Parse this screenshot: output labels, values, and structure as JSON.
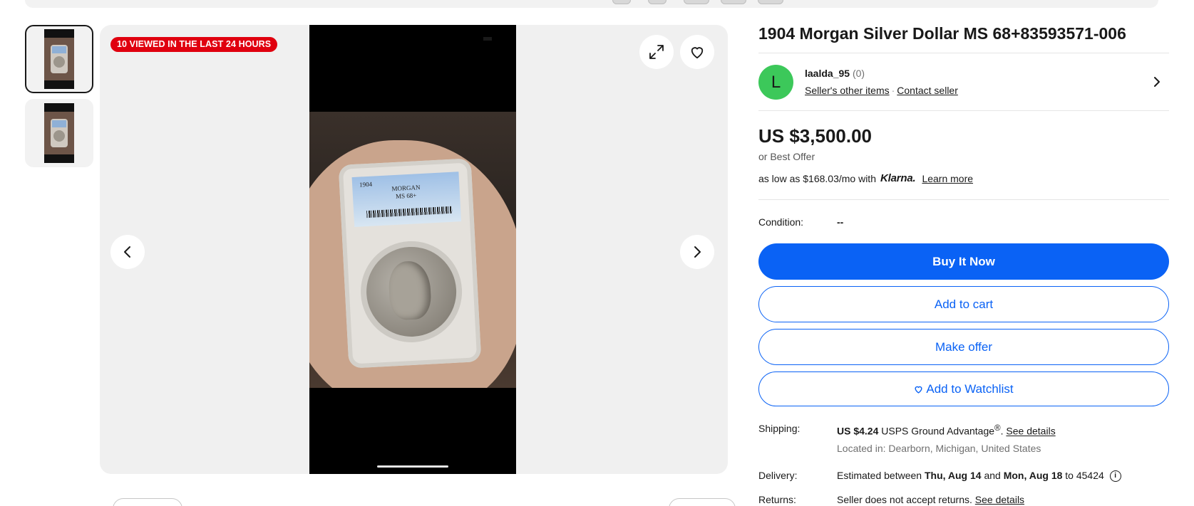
{
  "gallery": {
    "viewed_badge": "10 VIEWED IN THE LAST 24 HOURS",
    "photo_label": {
      "year": "1904",
      "name": "MORGAN",
      "grade": "MS 68+"
    },
    "icons": {
      "expand": "expand-icon",
      "watch": "heart-icon",
      "prev": "chevron-left-icon",
      "next": "chevron-right-icon"
    }
  },
  "thumbnails": [
    {
      "label": "thumbnail-1",
      "active": true
    },
    {
      "label": "thumbnail-2",
      "active": false
    }
  ],
  "item": {
    "title": "1904 Morgan Silver Dollar MS 68+83593571-006"
  },
  "seller": {
    "avatar_letter": "L",
    "avatar_color": "#3cc85a",
    "name": "laalda_95",
    "feedback_count": "(0)",
    "other_items_label": "Seller's other items",
    "separator": "·",
    "contact_label": "Contact seller"
  },
  "pricing": {
    "price": "US $3,500.00",
    "best_offer": "or Best Offer",
    "financing_prefix": "as low as $168.03/mo with",
    "klarna": "Klarna.",
    "learn_more": "Learn more"
  },
  "condition": {
    "label": "Condition:",
    "value": "--"
  },
  "actions": {
    "buy_now": "Buy It Now",
    "add_to_cart": "Add to cart",
    "make_offer": "Make offer",
    "watchlist": "Add to Watchlist",
    "primary_color": "#0a62f5"
  },
  "shipping": {
    "label": "Shipping:",
    "cost": "US $4.24",
    "service": "USPS Ground Advantage",
    "registered": "®",
    "period": ".",
    "details_link": "See details",
    "location": "Located in: Dearborn, Michigan, United States"
  },
  "delivery": {
    "label": "Delivery:",
    "prefix": "Estimated between",
    "start": "Thu, Aug 14",
    "and": "and",
    "end": "Mon, Aug 18",
    "to": "to 45424",
    "info_icon": "info-icon"
  },
  "returns": {
    "label": "Returns:",
    "text": "Seller does not accept returns.",
    "details_link": "See details"
  },
  "colors": {
    "badge_red": "#e0000f",
    "link_blue": "#0a62f5"
  }
}
